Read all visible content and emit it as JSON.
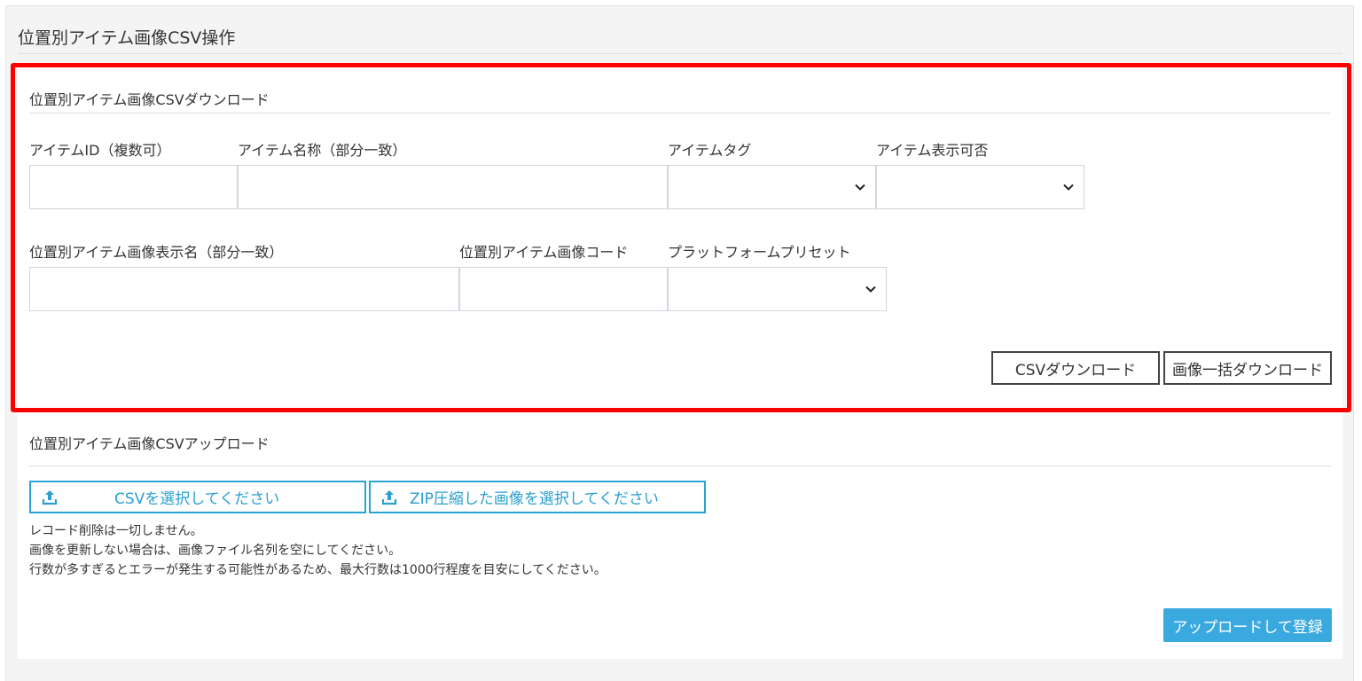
{
  "page": {
    "title": "位置別アイテム画像CSV操作"
  },
  "download": {
    "title": "位置別アイテム画像CSVダウンロード",
    "fields": {
      "item_id_label": "アイテムID（複数可）",
      "item_name_label": "アイテム名称（部分一致）",
      "item_tag_label": "アイテムタグ",
      "item_visibility_label": "アイテム表示可否",
      "image_display_name_label": "位置別アイテム画像表示名（部分一致）",
      "image_code_label": "位置別アイテム画像コード",
      "platform_preset_label": "プラットフォームプリセット"
    },
    "buttons": {
      "csv_download": "CSVダウンロード",
      "bulk_image_download": "画像一括ダウンロード"
    }
  },
  "upload": {
    "title": "位置別アイテム画像CSVアップロード",
    "select_csv": "CSVを選択してください",
    "select_zip": "ZIP圧縮した画像を選択してください",
    "notes": [
      "レコード削除は一切しません。",
      "画像を更新しない場合は、画像ファイル名列を空にしてください。",
      "行数が多すぎるとエラーが発生する可能性があるため、最大行数は1000行程度を目安にしてください。"
    ],
    "submit": "アップロードして登録"
  },
  "colors": {
    "highlight": "#ff0000",
    "accent": "#29a3d6",
    "primary_button": "#3aa9df"
  }
}
